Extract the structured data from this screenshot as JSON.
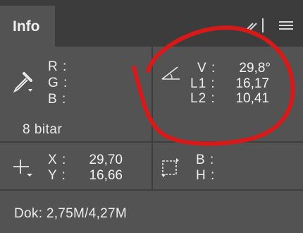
{
  "panel": {
    "tab_label": "Info"
  },
  "rgb": {
    "r_label": "R :",
    "g_label": "G :",
    "b_label": "B :",
    "bit_depth": "8 bitar"
  },
  "angle": {
    "v_label": "V :",
    "l1_label": "L1 :",
    "l2_label": "L2 :",
    "v_value": "29,8°",
    "l1_value": "16,17",
    "l2_value": "10,41"
  },
  "position": {
    "x_label": "X :",
    "y_label": "Y :",
    "x_value": "29,70",
    "y_value": "16,66"
  },
  "size": {
    "b_label": "B :",
    "h_label": "H :"
  },
  "status": {
    "document_size": "Dok: 2,75M/4,27M"
  },
  "colors": {
    "panel_bg": "#535353",
    "tabbar_bg": "#3c3c3c",
    "annotation": "#d61a1a"
  },
  "icons": [
    "eyedropper-icon",
    "angle-icon",
    "crosshair-icon",
    "marquee-icon",
    "collapse-icon",
    "panel-menu-icon"
  ]
}
